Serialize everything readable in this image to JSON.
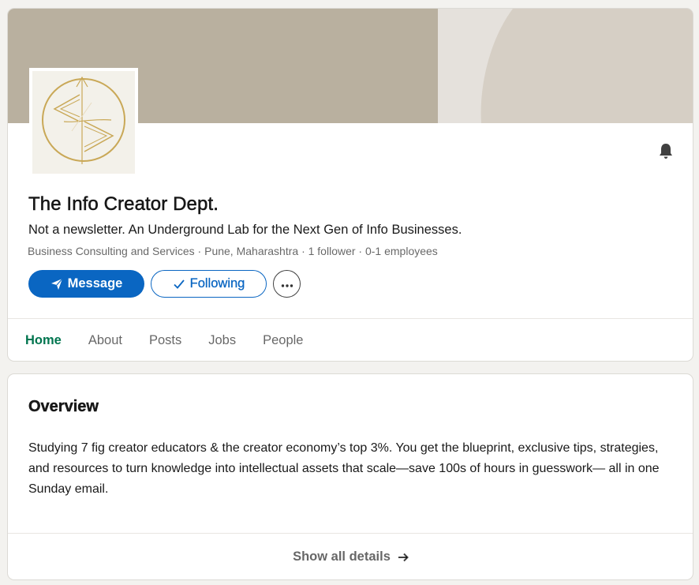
{
  "company": {
    "name": "The Info Creator Dept.",
    "tagline": "Not a newsletter. An Underground Lab for the Next Gen of Info Businesses.",
    "meta": "Business Consulting and Services · Pune, Maharashtra · 1 follower · 0-1 employees"
  },
  "actions": {
    "message_label": "Message",
    "following_label": "Following",
    "more_icon": "ellipsis-icon",
    "bell_icon": "bell-icon"
  },
  "tabs": [
    {
      "label": "Home",
      "active": true
    },
    {
      "label": "About",
      "active": false
    },
    {
      "label": "Posts",
      "active": false
    },
    {
      "label": "Jobs",
      "active": false
    },
    {
      "label": "People",
      "active": false
    }
  ],
  "overview": {
    "title": "Overview",
    "text": "Studying 7 fig creator educators & the creator economy’s top 3%. You get the blueprint, exclusive tips, strategies, and resources to turn knowledge into intellectual assets that scale—save 100s of hours in guesswork— all in one Sunday email.",
    "show_all_label": "Show all details"
  },
  "colors": {
    "primary": "#0a66c2",
    "tab_active": "#01754f",
    "banner_left": "#b9b09f",
    "banner_right": "#d6cfc5",
    "logo_gold": "#c9a857"
  }
}
